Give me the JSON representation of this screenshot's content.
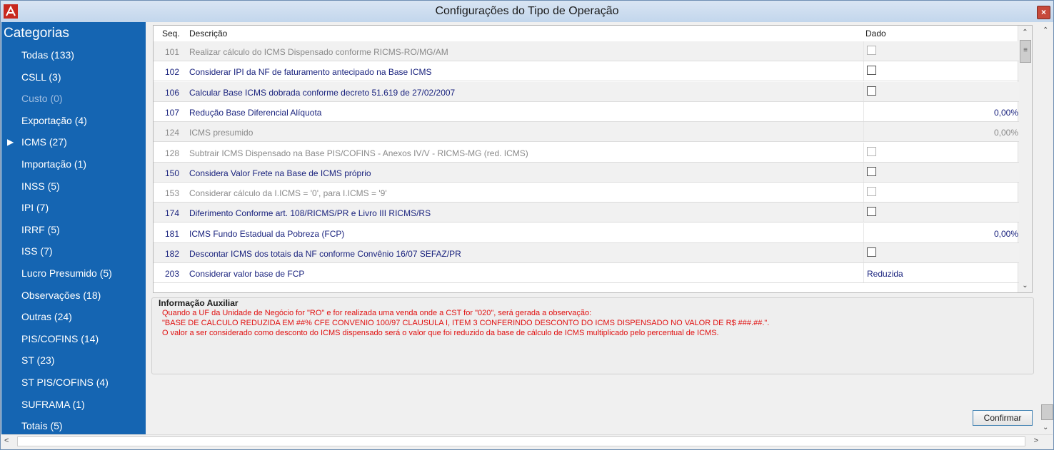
{
  "window": {
    "title": "Configurações do Tipo de Operação",
    "close_glyph": "×"
  },
  "sidebar": {
    "heading": "Categorias",
    "selected_marker": "▶",
    "items": [
      {
        "label": "Todas (133)",
        "enabled": true
      },
      {
        "label": "CSLL (3)",
        "enabled": true
      },
      {
        "label": "Custo (0)",
        "enabled": false
      },
      {
        "label": "Exportação (4)",
        "enabled": true
      },
      {
        "label": "ICMS (27)",
        "enabled": true,
        "selected": true
      },
      {
        "label": "Importação (1)",
        "enabled": true
      },
      {
        "label": "INSS (5)",
        "enabled": true
      },
      {
        "label": "IPI (7)",
        "enabled": true
      },
      {
        "label": "IRRF (5)",
        "enabled": true
      },
      {
        "label": "ISS (7)",
        "enabled": true
      },
      {
        "label": "Lucro Presumido (5)",
        "enabled": true
      },
      {
        "label": "Observações (18)",
        "enabled": true
      },
      {
        "label": "Outras (24)",
        "enabled": true
      },
      {
        "label": "PIS/COFINS (14)",
        "enabled": true
      },
      {
        "label": "ST (23)",
        "enabled": true
      },
      {
        "label": "ST PIS/COFINS (4)",
        "enabled": true
      },
      {
        "label": "SUFRAMA (1)",
        "enabled": true
      },
      {
        "label": "Totais (5)",
        "enabled": true
      }
    ]
  },
  "grid": {
    "headers": {
      "seq": "Seq.",
      "desc": "Descrição",
      "dado": "Dado"
    },
    "rows": [
      {
        "seq": "101",
        "desc": "Realizar cálculo do ICMS Dispensado conforme RICMS-RO/MG/AM",
        "kind": "checkbox",
        "enabled": false,
        "alt": true
      },
      {
        "seq": "102",
        "desc": "Considerar IPI da NF de faturamento antecipado na Base ICMS",
        "kind": "checkbox",
        "enabled": true,
        "alt": false
      },
      {
        "seq": "106",
        "desc": "Calcular Base ICMS dobrada conforme decreto 51.619 de 27/02/2007",
        "kind": "checkbox",
        "enabled": true,
        "alt": true
      },
      {
        "seq": "107",
        "desc": "Redução Base Diferencial Alíquota",
        "kind": "number",
        "value": "0,00%",
        "enabled": true,
        "alt": false
      },
      {
        "seq": "124",
        "desc": "ICMS presumido",
        "kind": "number",
        "value": "0,00%",
        "enabled": false,
        "alt": true
      },
      {
        "seq": "128",
        "desc": "Subtrair ICMS Dispensado na Base PIS/COFINS - Anexos IV/V - RICMS-MG (red. ICMS)",
        "kind": "checkbox",
        "enabled": false,
        "alt": false
      },
      {
        "seq": "150",
        "desc": "Considera Valor Frete na Base de ICMS próprio",
        "kind": "checkbox",
        "enabled": true,
        "alt": true
      },
      {
        "seq": "153",
        "desc": "Considerar cálculo da I.ICMS = '0', para I.ICMS = '9'",
        "kind": "checkbox",
        "enabled": false,
        "alt": false
      },
      {
        "seq": "174",
        "desc": "Diferimento Conforme art. 108/RICMS/PR e Livro III RICMS/RS",
        "kind": "checkbox",
        "enabled": true,
        "alt": true
      },
      {
        "seq": "181",
        "desc": "ICMS Fundo Estadual da Pobreza (FCP)",
        "kind": "number",
        "value": "0,00%",
        "enabled": true,
        "alt": false
      },
      {
        "seq": "182",
        "desc": "Descontar ICMS dos totais da NF conforme Convênio 16/07 SEFAZ/PR",
        "kind": "checkbox",
        "enabled": true,
        "alt": true
      },
      {
        "seq": "203",
        "desc": "Considerar valor base de FCP",
        "kind": "text",
        "value": "Reduzida",
        "enabled": true,
        "alt": false
      }
    ]
  },
  "info": {
    "title": "Informação Auxiliar",
    "lines": [
      "Quando a UF da Unidade de Negócio for \"RO\" e for realizada uma venda onde a CST for \"020\", será gerada a observação:",
      "\"BASE DE CALCULO REDUZIDA EM ##% CFE CONVENIO 100/97 CLAUSULA I, ITEM 3 CONFERINDO DESCONTO DO ICMS DISPENSADO NO VALOR DE R$ ###.##.\".",
      "O valor a ser considerado como desconto do ICMS dispensado será o valor que foi reduzido da base de cálculo de ICMS multiplicado pelo percentual de ICMS."
    ]
  },
  "buttons": {
    "confirm": "Confirmar"
  },
  "scroll": {
    "up": "⌃",
    "down": "⌄",
    "left": "<",
    "right": ">",
    "thumb": "≡"
  },
  "colors": {
    "sidebar_bg": "#1565b2",
    "enabled_text": "#1a237e",
    "disabled_text": "#8a8a8a",
    "info_text": "#e01010"
  }
}
